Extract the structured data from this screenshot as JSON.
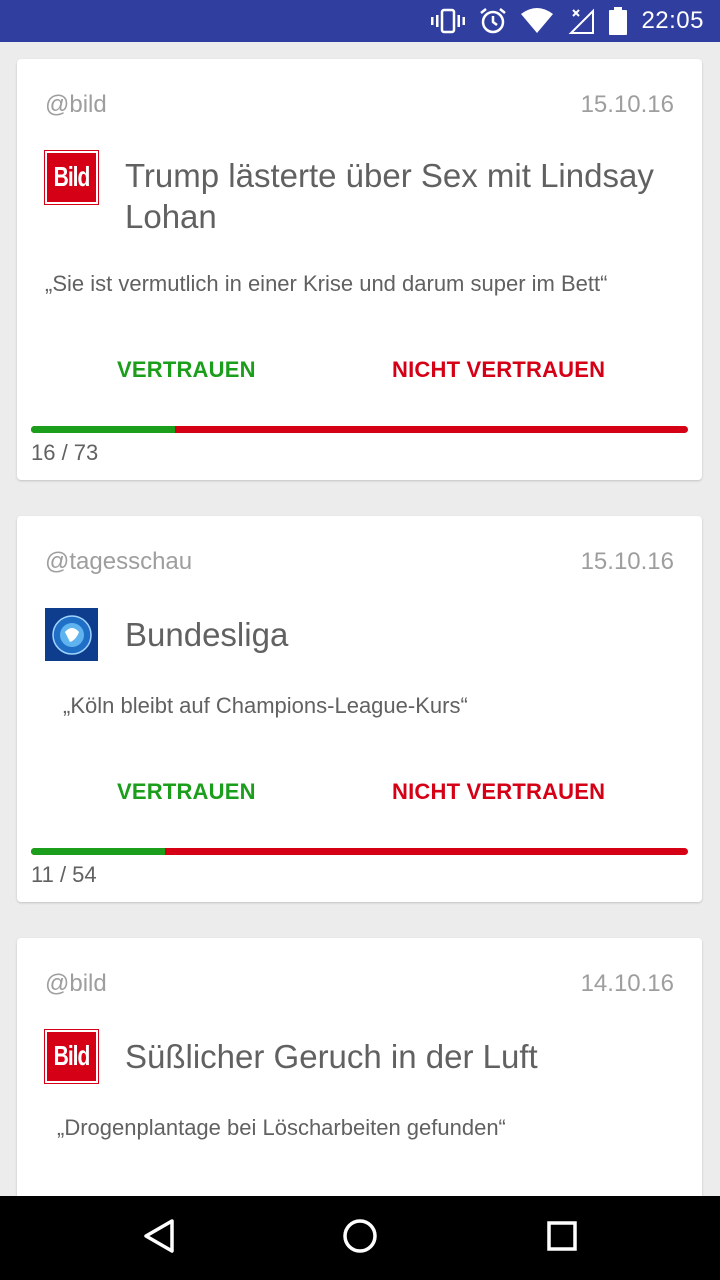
{
  "status_bar": {
    "time": "22:05",
    "icons": [
      "vibrate-icon",
      "alarm-icon",
      "wifi-icon",
      "cell-signal-icon",
      "battery-icon"
    ]
  },
  "colors": {
    "status_bar": "#303f9f",
    "trust": "#1b9e1b",
    "distrust": "#d50015",
    "text_secondary": "#9e9e9e",
    "text_primary": "#616161"
  },
  "cards": [
    {
      "source": "@bild",
      "date": "15.10.16",
      "logo": "bild-logo",
      "logo_text": "Bild",
      "headline": "Trump lästerte über Sex mit Lindsay Lohan",
      "quote": "„Sie ist vermutlich in einer Krise und darum super im Bett“",
      "trust_label": "VERTRAUEN",
      "distrust_label": "NICHT VERTRAUEN",
      "trust_ratio": 0.219,
      "counts": "16 / 73"
    },
    {
      "source": "@tagesschau",
      "date": "15.10.16",
      "logo": "tagesschau-logo",
      "headline": "Bundesliga",
      "quote": "„Köln bleibt auf Champions-League-Kurs“",
      "trust_label": "VERTRAUEN",
      "distrust_label": "NICHT VERTRAUEN",
      "trust_ratio": 0.204,
      "counts": "11 / 54"
    },
    {
      "source": "@bild",
      "date": "14.10.16",
      "logo": "bild-logo",
      "logo_text": "Bild",
      "headline": "Süßlicher Geruch in der Luft",
      "quote": "„Drogenplantage bei Löscharbeiten gefunden“"
    }
  ],
  "nav_bar": {
    "buttons": [
      "back-icon",
      "home-icon",
      "recents-icon"
    ]
  }
}
